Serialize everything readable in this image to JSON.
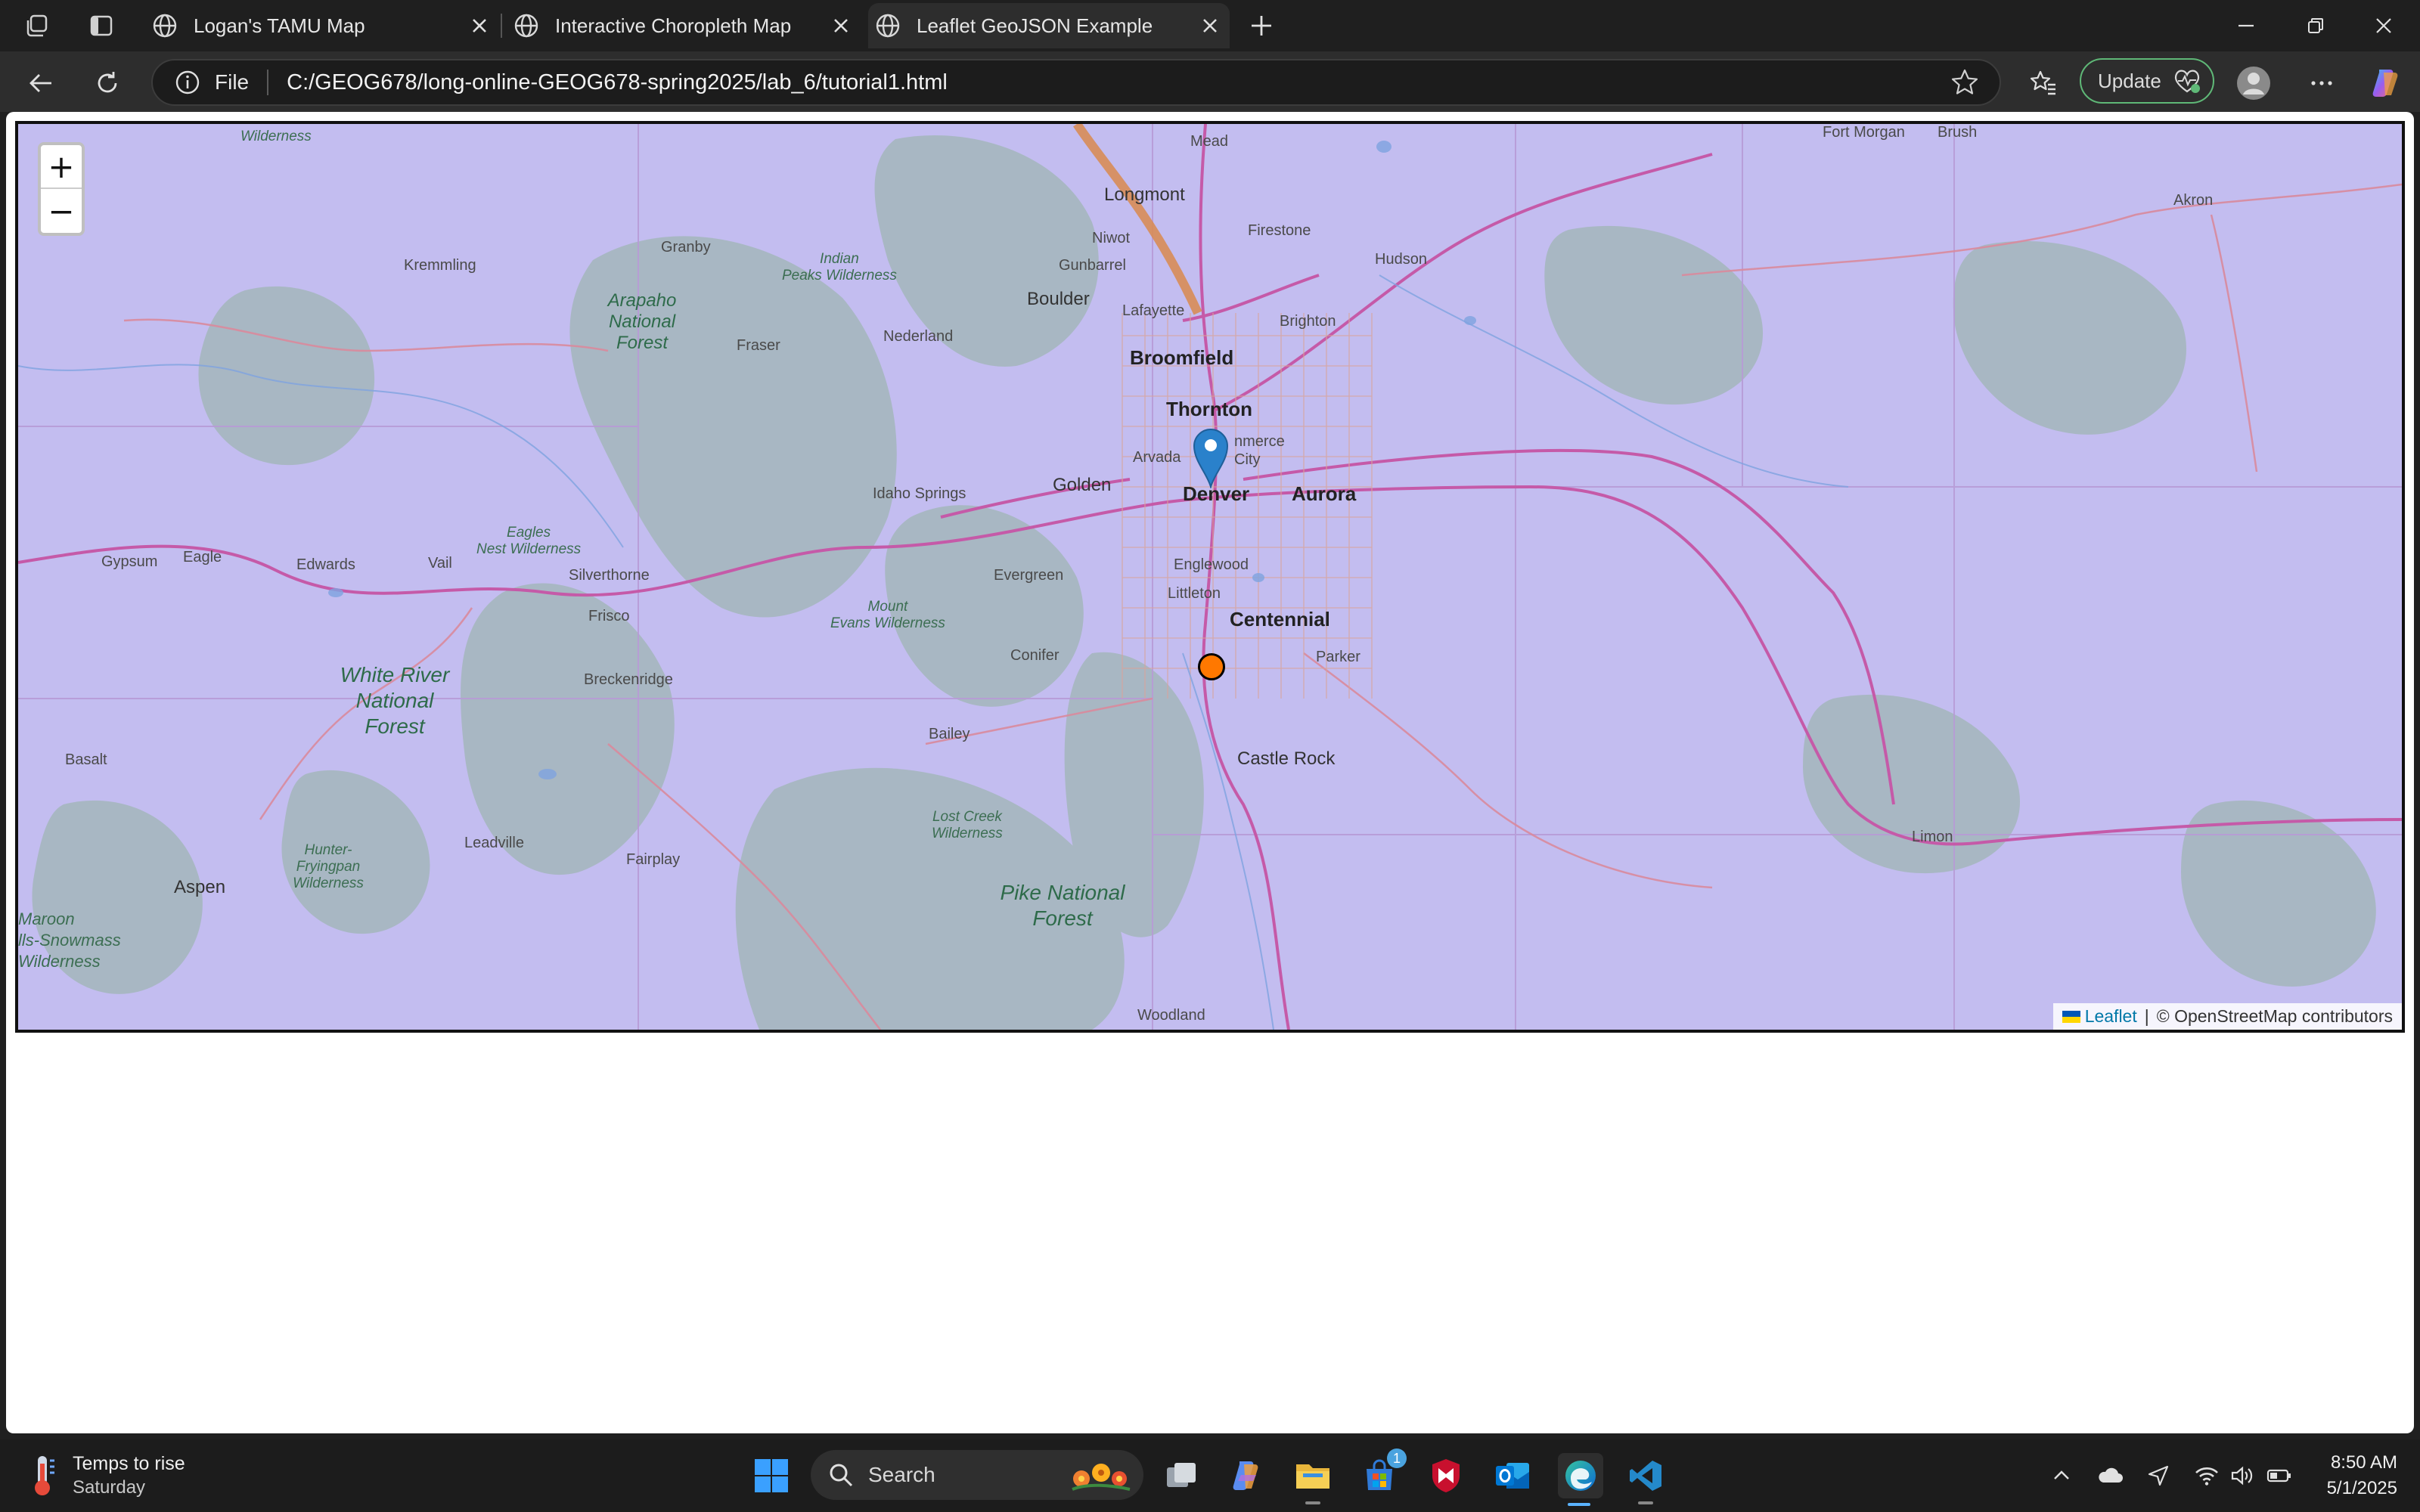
{
  "browser": {
    "tabs": [
      {
        "label": "Logan's TAMU Map",
        "active": false
      },
      {
        "label": "Interactive Choropleth Map",
        "active": false
      },
      {
        "label": "Leaflet GeoJSON Example",
        "active": true
      }
    ],
    "address": {
      "scheme_label": "File",
      "url": "C:/GEOG678/long-online-GEOG678-spring2025/lab_6/tutorial1.html"
    },
    "update_label": "Update"
  },
  "map": {
    "zoom_in": "+",
    "zoom_out": "−",
    "fill_color": "#c3bdf0",
    "point_color": "#ff7800",
    "attribution": {
      "leaflet": "Leaflet",
      "separator": "|",
      "osm": "© OpenStreetMap contributors"
    },
    "places": {
      "wilderness_top": "Wilderness",
      "mead": "Mead",
      "fort_morgan": "Fort Morgan",
      "brush": "Brush",
      "akron": "Akron",
      "longmont": "Longmont",
      "niwot": "Niwot",
      "firestone": "Firestone",
      "granby": "Granby",
      "indian_peaks": "Indian\nPeaks Wilderness",
      "kremmling": "Kremmling",
      "gunbarrel": "Gunbarrel",
      "hudson": "Hudson",
      "boulder": "Boulder",
      "lafayette": "Lafayette",
      "brighton": "Brighton",
      "arapaho": "Arapaho\nNational\nForest",
      "fraser": "Fraser",
      "nederland": "Nederland",
      "broomfield": "Broomfield",
      "thornton": "Thornton",
      "commerce_city": "nmerce\nCity",
      "arvada": "Arvada",
      "golden": "Golden",
      "idaho_springs": "Idaho Springs",
      "denver": "Denver",
      "aurora": "Aurora",
      "eagles_nest": "Eagles\nNest Wilderness",
      "gypsum": "Gypsum",
      "eagle": "Eagle",
      "edwards": "Edwards",
      "vail": "Vail",
      "silverthorne": "Silverthorne",
      "evergreen": "Evergreen",
      "englewood": "Englewood",
      "littleton": "Littleton",
      "mount_evans": "Mount\nEvans Wilderness",
      "frisco": "Frisco",
      "centennial": "Centennial",
      "white_river": "White River\nNational\nForest",
      "breckenridge": "Breckenridge",
      "conifer": "Conifer",
      "parker": "Parker",
      "basalt": "Basalt",
      "bailey": "Bailey",
      "castle_rock": "Castle Rock",
      "lost_creek": "Lost Creek\nWilderness",
      "limon": "Limon",
      "hunter_fryingpan": "Hunter-\nFryingpan\nWilderness",
      "leadville": "Leadville",
      "fairplay": "Fairplay",
      "aspen": "Aspen",
      "pike": "Pike National\nForest",
      "maroon_bells": "Maroon\nlls-Snowmass\nWilderness",
      "woodland": "Woodland"
    }
  },
  "taskbar": {
    "weather_line1": "Temps to rise",
    "weather_line2": "Saturday",
    "search_placeholder": "Search",
    "store_badge": "1",
    "time": "8:50 AM",
    "date": "5/1/2025"
  }
}
